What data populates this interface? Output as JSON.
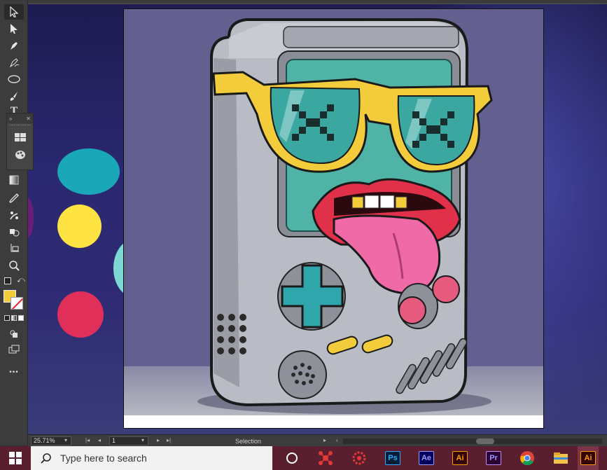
{
  "colors": {
    "workspace_bg": "#2a2870",
    "swatch_teal": "#1aa8b8",
    "swatch_yellow": "#ffe343",
    "swatch_cyan": "#7dd8d4",
    "swatch_red": "#e0305a",
    "fill_color": "#f2cc3a",
    "taskbar": "#5a1f2e"
  },
  "toolbar": {
    "tools": [
      "selection-tool-icon",
      "direct-selection-tool-icon",
      "pen-tool-icon",
      "curvature-tool-icon",
      "ellipse-tool-icon",
      "paintbrush-tool-icon",
      "type-tool-icon",
      "gradient-tool-icon",
      "eyedropper-tool-icon",
      "puppet-warp-tool-icon",
      "shape-builder-tool-icon",
      "artboard-tool-icon",
      "zoom-tool-icon"
    ],
    "type_glyph": "T",
    "more_glyph": "•••"
  },
  "status": {
    "zoom": "25.71%",
    "artboard_number": "1",
    "tool_name": "Selection"
  },
  "taskbar": {
    "search_placeholder": "Type here to search",
    "apps": [
      {
        "name": "Ps",
        "color": "#31a8ff",
        "bg": "#001e36"
      },
      {
        "name": "Ae",
        "color": "#9999ff",
        "bg": "#00005b"
      },
      {
        "name": "Ai",
        "color": "#ff9a00",
        "bg": "#330000"
      },
      {
        "name": "Pr",
        "color": "#9999ff",
        "bg": "#2a0034"
      },
      {
        "name": "Ai",
        "color": "#ff9a00",
        "bg": "#330000"
      }
    ]
  }
}
